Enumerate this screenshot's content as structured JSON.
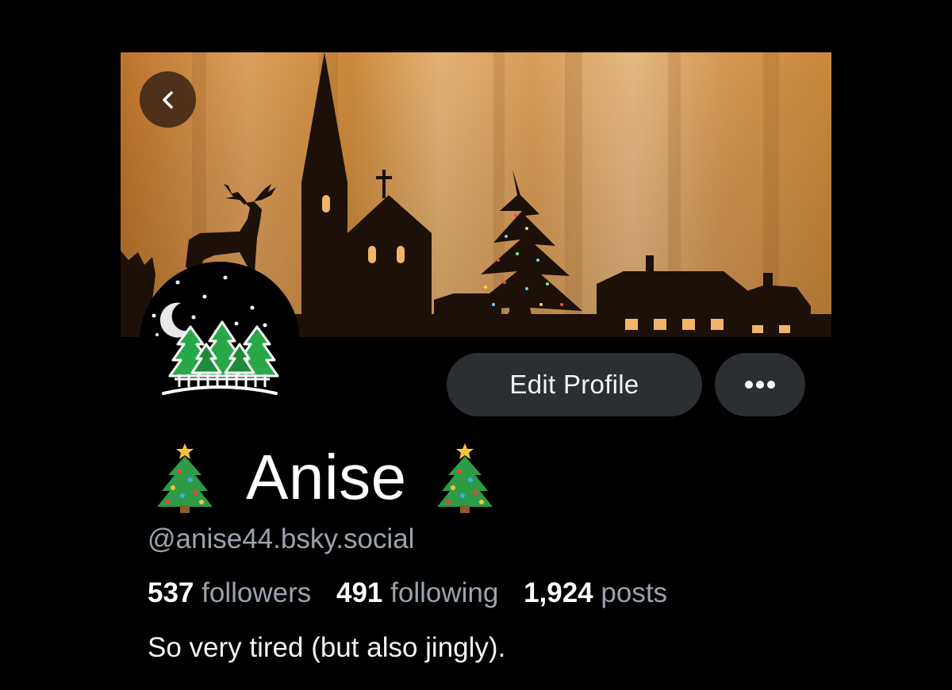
{
  "profile": {
    "display_name": "Anise",
    "name_emoji": "christmas-tree-emoji",
    "handle": "@anise44.bsky.social",
    "bio": "So very tired (but also jingly)."
  },
  "stats": {
    "followers_count": "537",
    "followers_label": "followers",
    "following_count": "491",
    "following_label": "following",
    "posts_count": "1,924",
    "posts_label": "posts"
  },
  "actions": {
    "edit_profile_label": "Edit Profile",
    "more_icon": "ellipsis-icon",
    "back_icon": "chevron-left-icon"
  },
  "banner": {
    "description_icon": "winter-village-silhouette"
  },
  "colors": {
    "background": "#000000",
    "button_bg": "#2b2e33",
    "muted_text": "#9ba3ad",
    "banner_glow": "#e3a45c"
  }
}
